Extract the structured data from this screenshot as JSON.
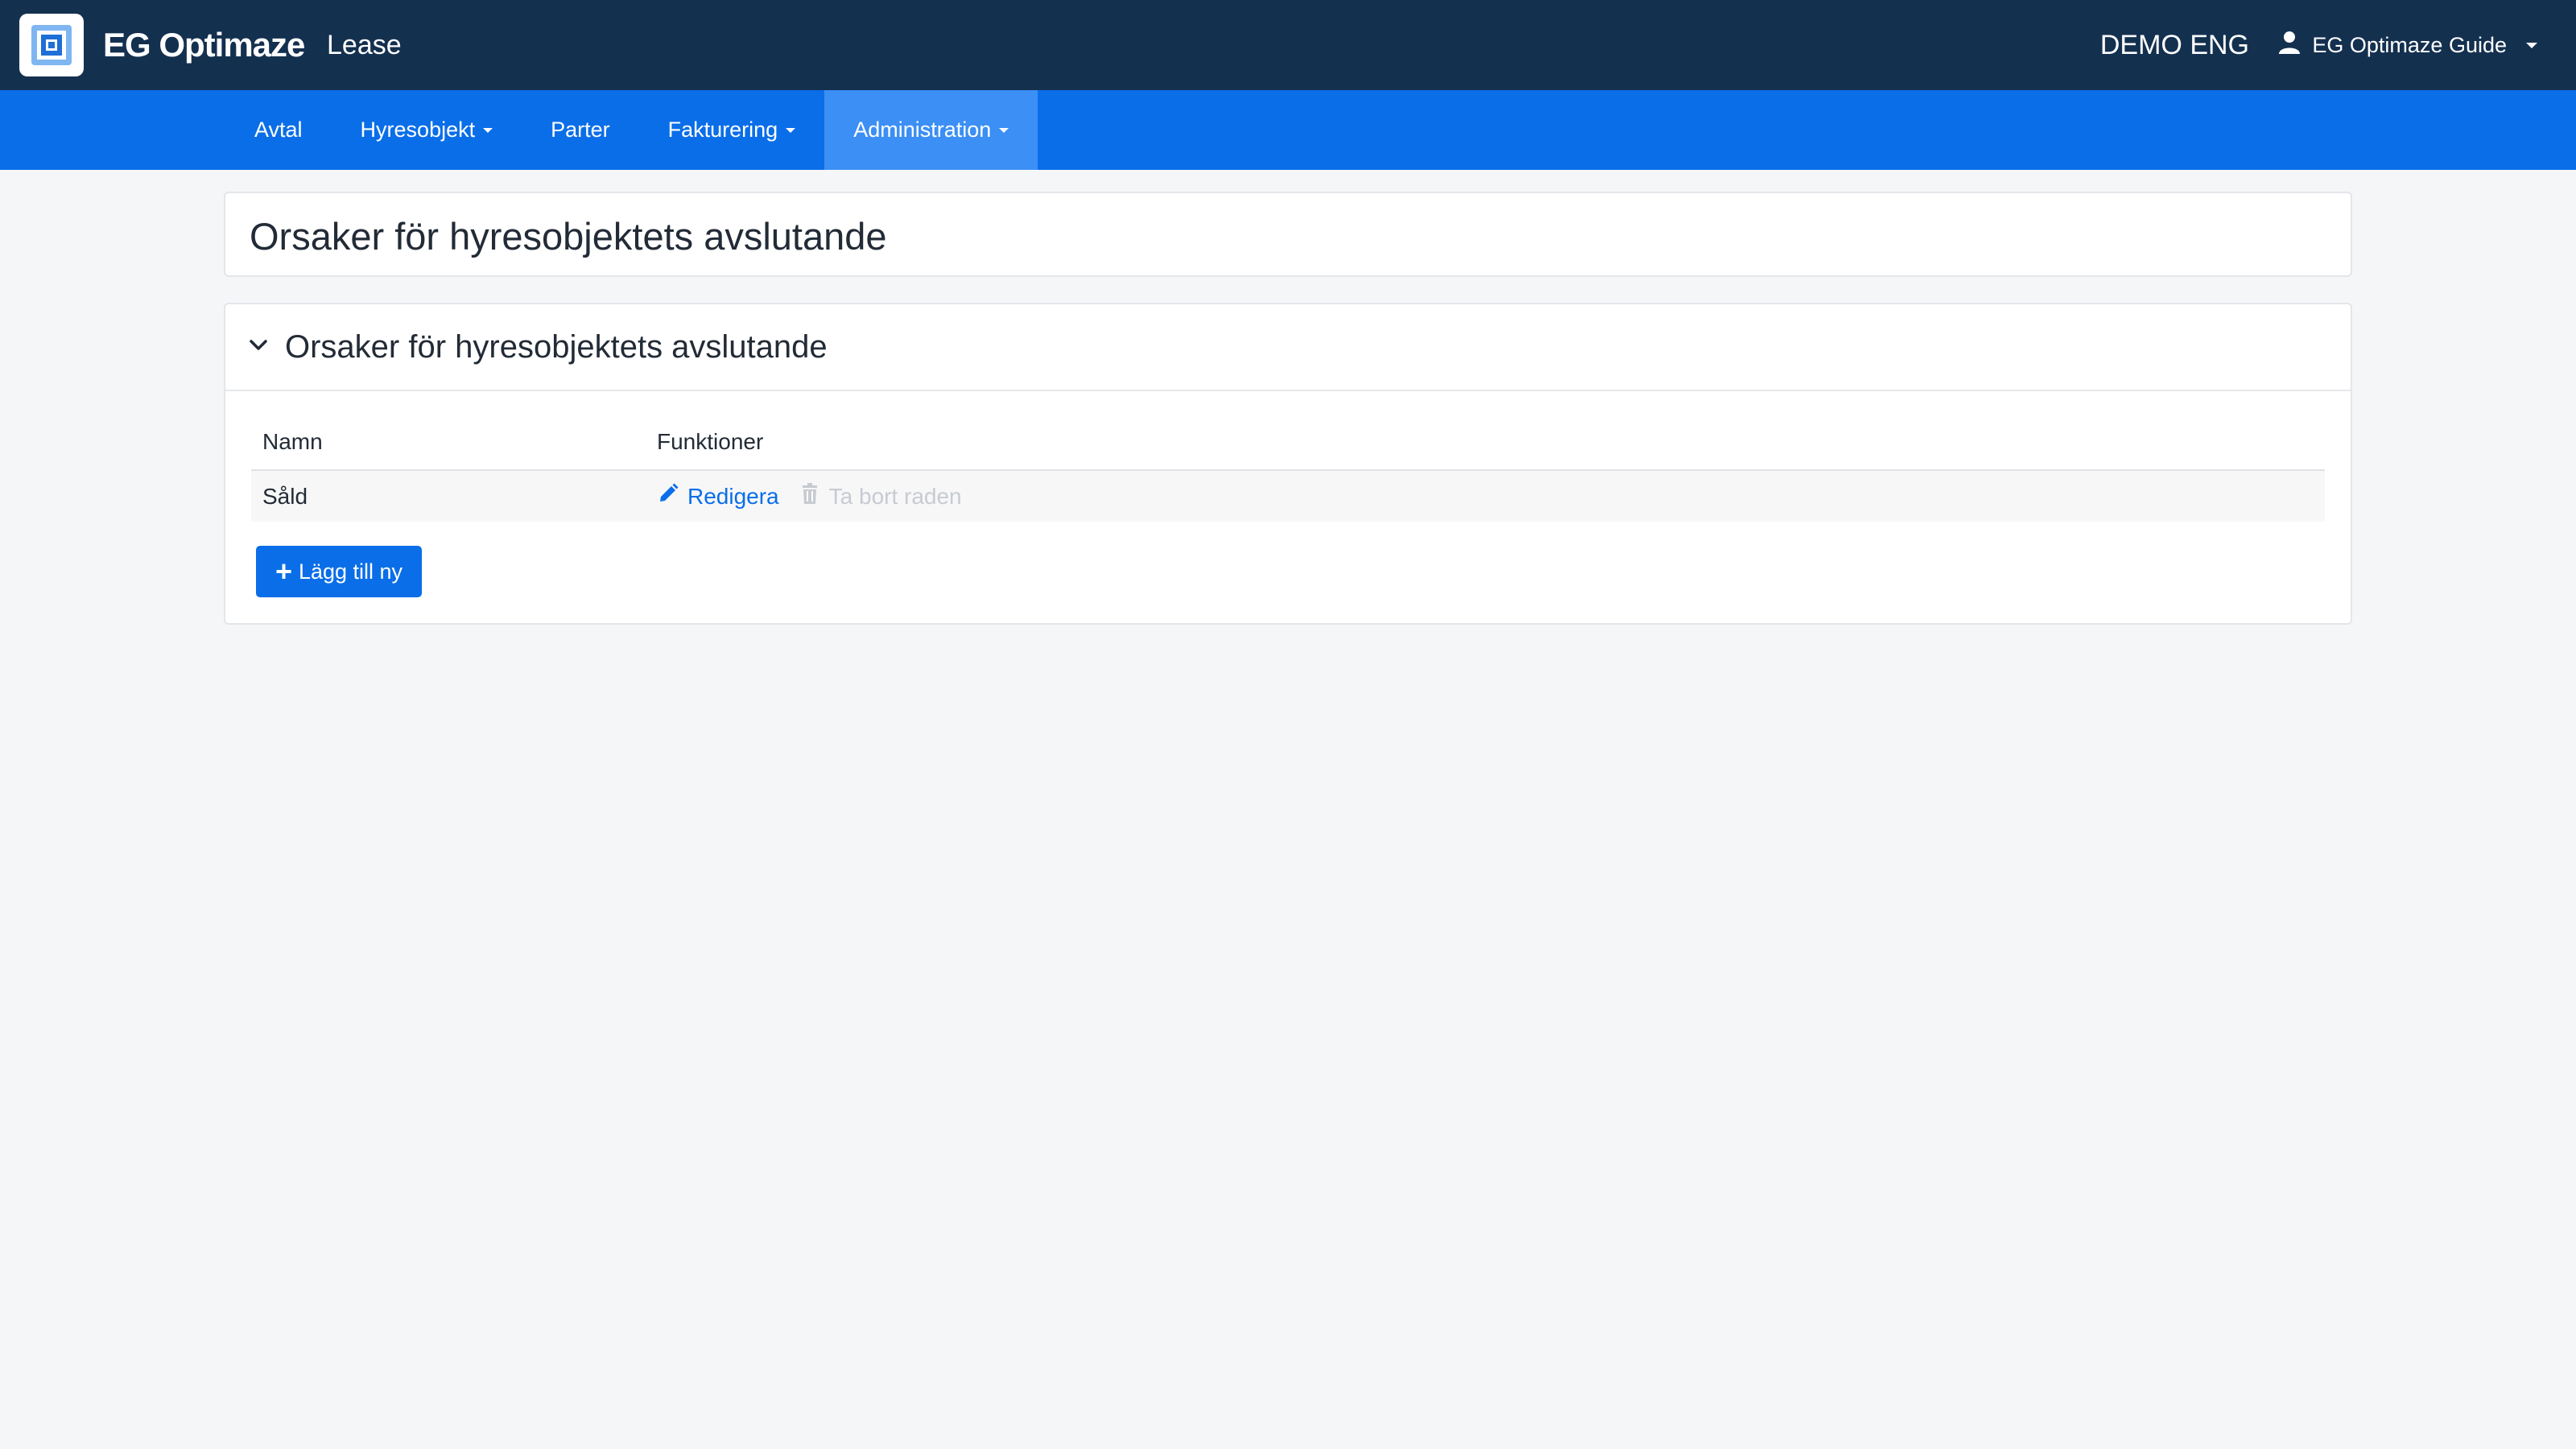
{
  "topbar": {
    "brand": "EG Optimaze",
    "module": "Lease",
    "environment": "DEMO ENG",
    "user_name": "EG Optimaze Guide",
    "logo_icon": "eg-logo-icon",
    "user_icon": "user-icon"
  },
  "nav": {
    "items": [
      {
        "label": "Avtal",
        "dropdown": false
      },
      {
        "label": "Hyresobjekt",
        "dropdown": true
      },
      {
        "label": "Parter",
        "dropdown": false
      },
      {
        "label": "Fakturering",
        "dropdown": true
      },
      {
        "label": "Administration",
        "dropdown": true,
        "active": true
      }
    ]
  },
  "page": {
    "title": "Orsaker för hyresobjektets avslutande"
  },
  "section": {
    "title": "Orsaker för hyresobjektets avslutande",
    "expanded": true,
    "columns": [
      "Namn",
      "Funktioner"
    ],
    "rows": [
      {
        "name": "Såld",
        "edit_label": "Redigera",
        "delete_label": "Ta bort raden"
      }
    ],
    "add_label": "Lägg till ny"
  },
  "colors": {
    "topbar": "#14304f",
    "navbar": "#0a6ee8",
    "nav_active": "#3b8ff5",
    "link": "#0a6ee8",
    "disabled": "#c7cbd1"
  }
}
